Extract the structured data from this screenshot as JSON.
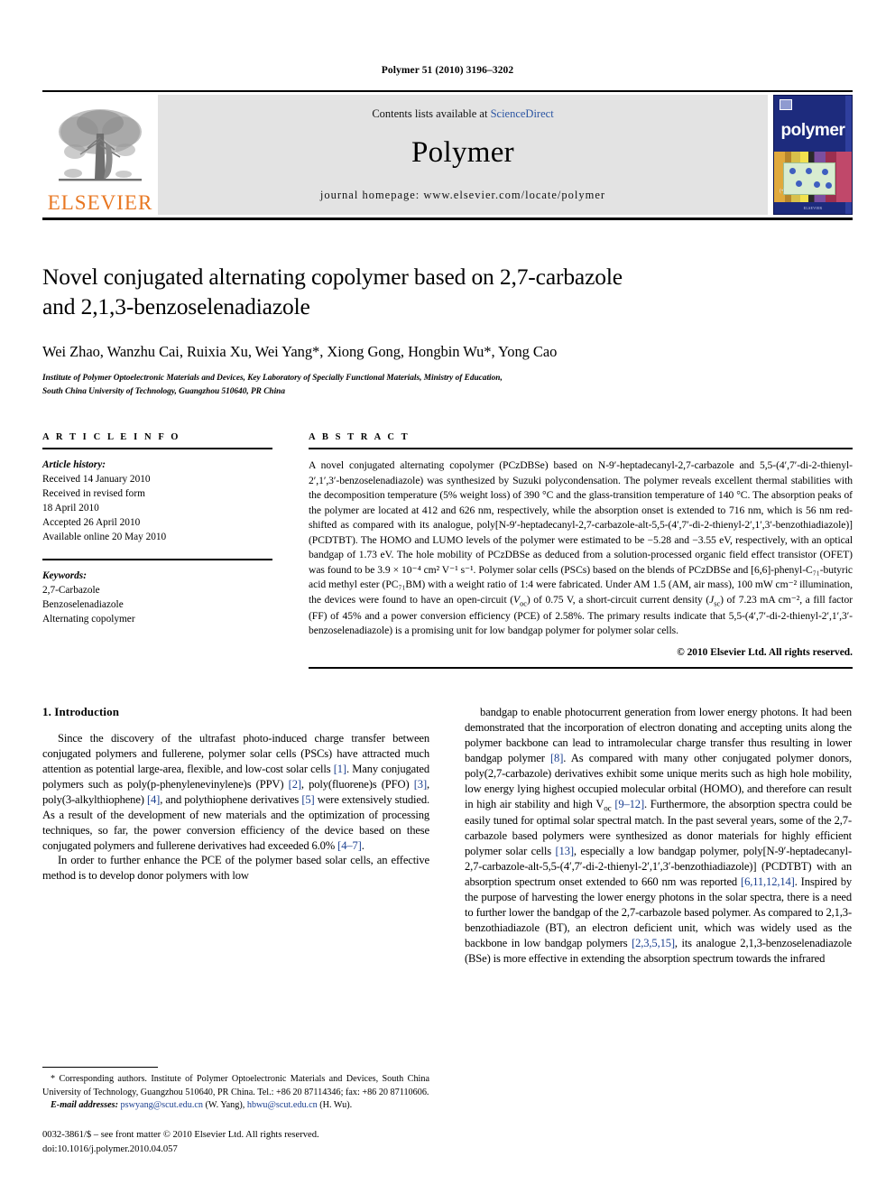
{
  "running_head": "Polymer 51 (2010) 3196–3202",
  "banner": {
    "publisher_name": "ELSEVIER",
    "contents_prefix": "Contents lists available at ",
    "sciencedirect": "ScienceDirect",
    "journal_title": "Polymer",
    "homepage": "journal homepage: www.elsevier.com/locate/polymer",
    "cover_word": "polymer",
    "cover_footer": "ELSEVIER"
  },
  "article": {
    "title_line1": "Novel conjugated alternating copolymer based on 2,7-carbazole",
    "title_line2": "and 2,1,3-benzoselenadiazole",
    "authors": "Wei Zhao, Wanzhu Cai, Ruixia Xu, Wei Yang*, Xiong Gong, Hongbin Wu*, Yong Cao",
    "affiliation_line1": "Institute of Polymer Optoelectronic Materials and Devices, Key Laboratory of Specially Functional Materials, Ministry of Education,",
    "affiliation_line2": "South China University of Technology, Guangzhou 510640, PR China"
  },
  "info": {
    "heading": "A R T I C L E   I N F O",
    "history_label": "Article history:",
    "history": [
      "Received 14 January 2010",
      "Received in revised form",
      "18 April 2010",
      "Accepted 26 April 2010",
      "Available online 20 May 2010"
    ],
    "keywords_label": "Keywords:",
    "keywords": [
      "2,7-Carbazole",
      "Benzoselenadiazole",
      "Alternating copolymer"
    ]
  },
  "abstract": {
    "heading": "A B S T R A C T",
    "text": "A novel conjugated alternating copolymer (PCzDBSe) based on N-9′-heptadecanyl-2,7-carbazole and 5,5-(4′,7′-di-2-thienyl-2′,1′,3′-benzoselenadiazole) was synthesized by Suzuki polycondensation. The polymer reveals excellent thermal stabilities with the decomposition temperature (5% weight loss) of 390 °C and the glass-transition temperature of 140 °C. The absorption peaks of the polymer are located at 412 and 626 nm, respectively, while the absorption onset is extended to 716 nm, which is 56 nm red-shifted as compared with its analogue, poly[N-9′-heptadecanyl-2,7-carbazole-alt-5,5-(4′,7′-di-2-thienyl-2′,1′,3′-benzothiadiazole)] (PCDTBT). The HOMO and LUMO levels of the polymer were estimated to be −5.28 and −3.55 eV, respectively, with an optical bandgap of 1.73 eV. The hole mobility of PCzDBSe as deduced from a solution-processed organic field effect transistor (OFET) was found to be 3.9 × 10⁻⁴ cm² V⁻¹ s⁻¹. Polymer solar cells (PSCs) based on the blends of PCzDBSe and [6,6]-phenyl-C₇₁-butyric acid methyl ester (PC₇₁BM) with a weight ratio of 1:4 were fabricated. Under AM 1.5 (AM, air mass), 100 mW cm⁻² illumination, the devices were found to have an open-circuit (Voc) of 0.75 V, a short-circuit current density (Jsc) of 7.23 mA cm⁻², a fill factor (FF) of 45% and a power conversion efficiency (PCE) of 2.58%. The primary results indicate that 5,5-(4′,7′-di-2-thienyl-2′,1′,3′-benzoselenadiazole) is a promising unit for low bandgap polymer for polymer solar cells.",
    "copyright": "© 2010 Elsevier Ltd. All rights reserved."
  },
  "body": {
    "section_title": "1.  Introduction",
    "left_para1": "Since the discovery of the ultrafast photo-induced charge transfer between conjugated polymers and fullerene, polymer solar cells (PSCs) have attracted much attention as potential large-area, flexible, and low-cost solar cells [1]. Many conjugated polymers such as poly(p-phenylenevinylene)s (PPV) [2], poly(fluorene)s (PFO) [3], poly(3-alkylthiophene) [4], and polythiophene derivatives [5] were extensively studied. As a result of the development of new materials and the optimization of processing techniques, so far, the power conversion efficiency of the device based on these conjugated polymers and fullerene derivatives had exceeded 6.0% [4–7].",
    "left_para2": "In order to further enhance the PCE of the polymer based solar cells, an effective method is to develop donor polymers with low",
    "right_para1": "bandgap to enable photocurrent generation from lower energy photons. It had been demonstrated that the incorporation of electron donating and accepting units along the polymer backbone can lead to intramolecular charge transfer thus resulting in lower bandgap polymer [8]. As compared with many other conjugated polymer donors, poly(2,7-carbazole) derivatives exhibit some unique merits such as high hole mobility, low energy lying highest occupied molecular orbital (HOMO), and therefore can result in high air stability and high Voc [9–12]. Furthermore, the absorption spectra could be easily tuned for optimal solar spectral match. In the past several years, some of the 2,7-carbazole based polymers were synthesized as donor materials for highly efficient polymer solar cells [13], especially a low bandgap polymer, poly[N-9′-heptadecanyl-2,7-carbazole-alt-5,5-(4′,7′-di-2-thienyl-2′,1′,3′-benzothiadiazole)] (PCDTBT) with an absorption spectrum onset extended to 660 nm was reported [6,11,12,14]. Inspired by the purpose of harvesting the lower energy photons in the solar spectra, there is a need to further lower the bandgap of the 2,7-carbazole based polymer. As compared to 2,1,3-benzothiadiazole (BT), an electron deficient unit, which was widely used as the backbone in low bandgap polymers [2,3,5,15], its analogue 2,1,3-benzoselenadiazole (BSe) is more effective in extending the absorption spectrum towards the infrared"
  },
  "footnotes": {
    "corresponding": "* Corresponding authors. Institute of Polymer Optoelectronic Materials and Devices, South China University of Technology, Guangzhou 510640, PR China. Tel.: +86 20 87114346; fax: +86 20 87110606.",
    "email_label": "E-mail addresses:",
    "email1": "pswyang@scut.edu.cn",
    "email1_who": "(W. Yang),",
    "email2": "hbwu@scut.edu.cn",
    "email2_who": "(H. Wu).",
    "issn_line": "0032-3861/$ – see front matter © 2010 Elsevier Ltd. All rights reserved.",
    "doi_line": "doi:10.1016/j.polymer.2010.04.057"
  },
  "colors": {
    "elsevier_orange": "#E87722",
    "link_blue": "#1b3f8f",
    "sciencedirect_blue": "#2b55a3",
    "banner_gray": "#e3e3e3",
    "cover_blue": "#1d2b7d"
  }
}
